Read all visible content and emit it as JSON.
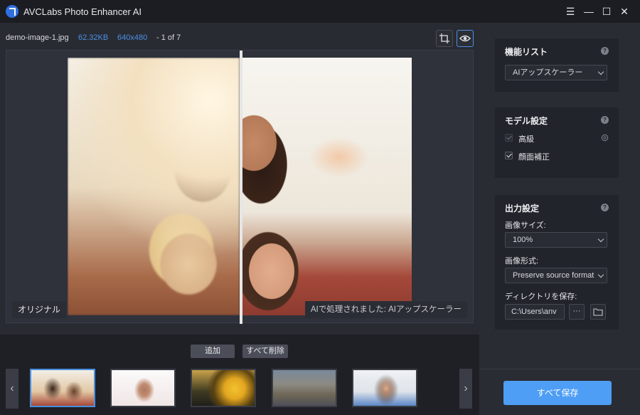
{
  "app": {
    "title": "AVCLabs Photo Enhancer AI"
  },
  "window_controls": [
    "menu-icon",
    "minimize-icon",
    "maximize-icon",
    "close-icon"
  ],
  "file_info": {
    "name": "demo-image-1.jpg",
    "size": "62.32KB",
    "dimensions": "640x480",
    "position": "- 1 of 7"
  },
  "preview": {
    "original_label": "オリジナル",
    "processed_label": "AIで処理されました: AIアップスケーラー"
  },
  "strip": {
    "add_label": "追加",
    "clear_label": "すべて削除",
    "thumbnails": [
      "group-selfie",
      "anime-girl",
      "sunflower",
      "city-square",
      "woman-peace-sign"
    ]
  },
  "panel": {
    "feature_list": {
      "title": "機能リスト",
      "selected": "AIアップスケーラー"
    },
    "model": {
      "title": "モデル設定",
      "advanced_label": "高級",
      "face_label": "顔面補正"
    },
    "output": {
      "title": "出力設定",
      "size_label": "画像サイズ:",
      "size_value": "100%",
      "format_label": "画像形式:",
      "format_value": "Preserve source format",
      "dir_label": "ディレクトリを保存:",
      "dir_value": "C:\\Users\\anv"
    },
    "save_all_label": "すべて保存"
  },
  "colors": {
    "accent": "#4e9ef5",
    "info_blue": "#4a90e2"
  }
}
